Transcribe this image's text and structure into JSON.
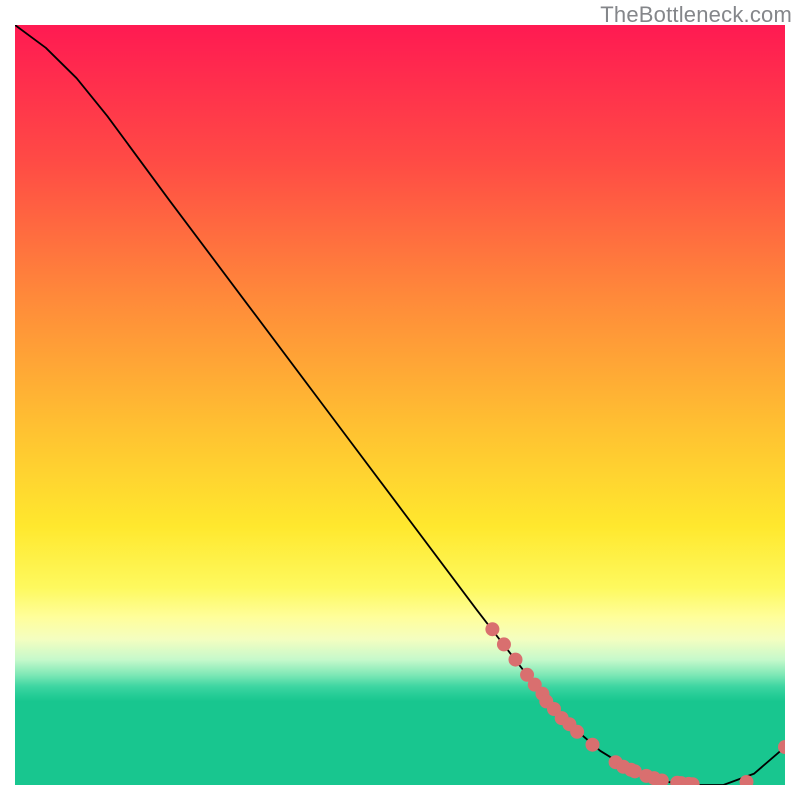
{
  "attribution": "TheBottleneck.com",
  "chart_data": {
    "type": "line",
    "title": "",
    "xlabel": "",
    "ylabel": "",
    "xlim": [
      0,
      100
    ],
    "ylim": [
      0,
      100
    ],
    "grid": false,
    "legend": false,
    "series": [
      {
        "name": "curve",
        "x": [
          0,
          4,
          8,
          12,
          20,
          30,
          40,
          50,
          60,
          68,
          72,
          76,
          80,
          84,
          88,
          92,
          96,
          100
        ],
        "y": [
          100,
          97,
          93,
          88,
          77,
          63.5,
          50,
          36.5,
          23,
          12.5,
          8,
          4.5,
          2,
          0.5,
          0,
          0,
          1.5,
          5
        ],
        "color": "#000000",
        "marker": false
      },
      {
        "name": "markers",
        "x": [
          62,
          63.5,
          65,
          66.5,
          67.5,
          68.5,
          69,
          70,
          71,
          72,
          73,
          75,
          78,
          79,
          80,
          80.5,
          82,
          83,
          84,
          86,
          86.5,
          87.5,
          88,
          95,
          100
        ],
        "y": [
          20.5,
          18.5,
          16.5,
          14.5,
          13.2,
          12,
          11,
          10,
          8.8,
          8,
          7,
          5.3,
          3,
          2.4,
          2,
          1.8,
          1.2,
          0.9,
          0.6,
          0.3,
          0.25,
          0.15,
          0.1,
          0.4,
          5
        ],
        "color": "#d96f6f",
        "marker": true
      }
    ],
    "colors": {
      "curve": "#000000",
      "markers": "#d96f6f"
    }
  }
}
